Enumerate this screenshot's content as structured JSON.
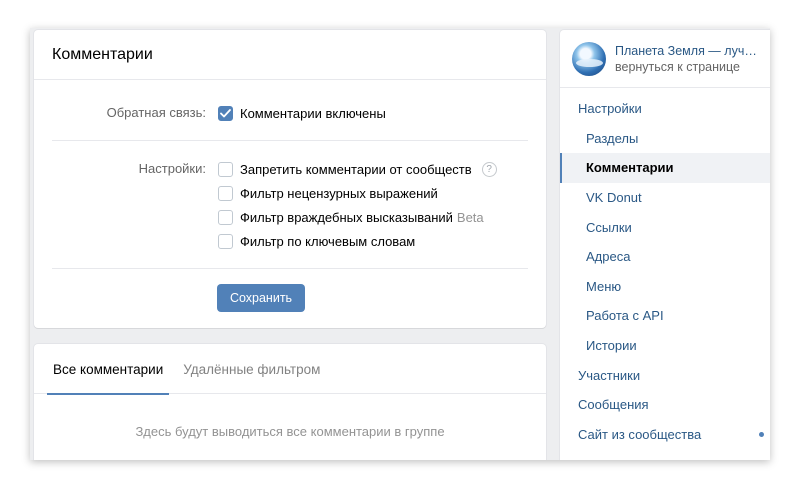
{
  "colors": {
    "accent": "#5181b8",
    "link": "#2a5885",
    "page_bg": "#edeef0"
  },
  "main": {
    "title": "Комментарии",
    "feedback": {
      "label": "Обратная связь:",
      "option": "Комментарии включены",
      "checked": true
    },
    "settings": {
      "label": "Настройки:",
      "options": [
        {
          "text": "Запретить комментарии от сообществ",
          "checked": false,
          "help_glyph": "?"
        },
        {
          "text": "Фильтр нецензурных выражений",
          "checked": false
        },
        {
          "text": "Фильтр враждебных высказываний",
          "checked": false,
          "badge": "Beta"
        },
        {
          "text": "Фильтр по ключевым словам",
          "checked": false
        }
      ]
    },
    "save_label": "Сохранить"
  },
  "comments": {
    "tabs": [
      {
        "label": "Все комментарии",
        "active": true
      },
      {
        "label": "Удалённые фильтром",
        "active": false
      }
    ],
    "empty_text": "Здесь будут выводиться все комментарии в группе"
  },
  "sidebar": {
    "group_name": "Планета Земля — лучши...",
    "back_link": "вернуться к странице",
    "items": [
      {
        "label": "Настройки",
        "level": "top"
      },
      {
        "label": "Разделы",
        "level": "sub"
      },
      {
        "label": "Комментарии",
        "level": "sub",
        "active": true
      },
      {
        "label": "VK Donut",
        "level": "sub"
      },
      {
        "label": "Ссылки",
        "level": "sub"
      },
      {
        "label": "Адреса",
        "level": "sub"
      },
      {
        "label": "Меню",
        "level": "sub"
      },
      {
        "label": "Работа с API",
        "level": "sub"
      },
      {
        "label": "Истории",
        "level": "sub"
      },
      {
        "label": "Участники",
        "level": "top"
      },
      {
        "label": "Сообщения",
        "level": "top"
      },
      {
        "label": "Сайт из сообщества",
        "level": "top",
        "dot": true
      }
    ]
  }
}
